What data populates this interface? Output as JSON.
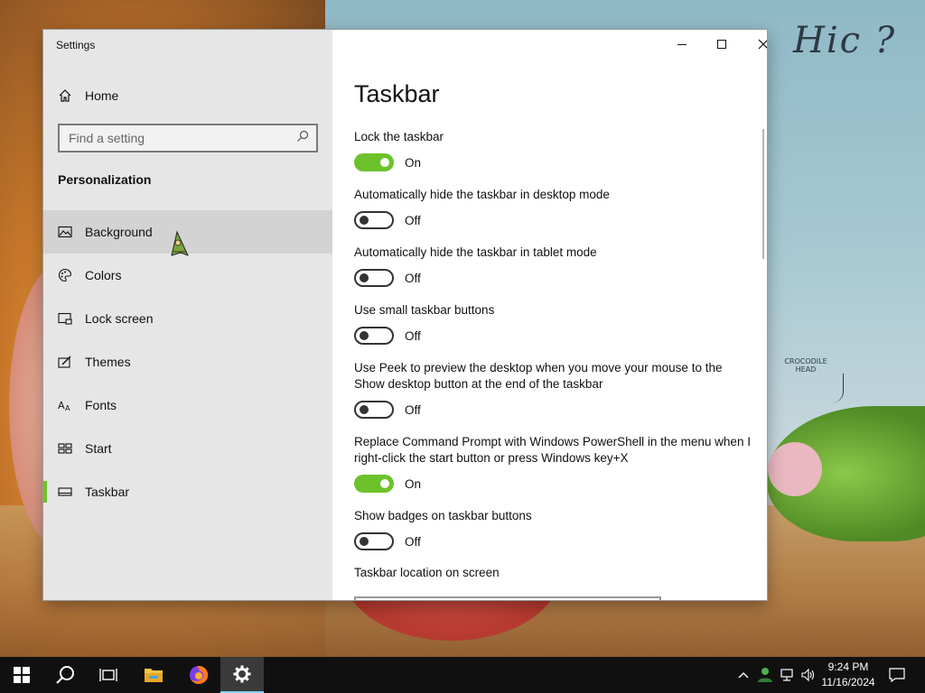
{
  "window": {
    "title": "Settings"
  },
  "sidebar": {
    "home_label": "Home",
    "search_placeholder": "Find a setting",
    "section_title": "Personalization",
    "items": [
      {
        "label": "Background",
        "icon": "image-icon"
      },
      {
        "label": "Colors",
        "icon": "palette-icon"
      },
      {
        "label": "Lock screen",
        "icon": "lock-screen-icon"
      },
      {
        "label": "Themes",
        "icon": "themes-icon"
      },
      {
        "label": "Fonts",
        "icon": "fonts-icon"
      },
      {
        "label": "Start",
        "icon": "start-icon"
      },
      {
        "label": "Taskbar",
        "icon": "taskbar-icon"
      }
    ],
    "selected": "Taskbar",
    "hovered": "Background"
  },
  "main": {
    "title": "Taskbar",
    "settings": [
      {
        "label": "Lock the taskbar",
        "state": "On"
      },
      {
        "label": "Automatically hide the taskbar in desktop mode",
        "state": "Off"
      },
      {
        "label": "Automatically hide the taskbar in tablet mode",
        "state": "Off"
      },
      {
        "label": "Use small taskbar buttons",
        "state": "Off"
      },
      {
        "label": "Use Peek to preview the desktop when you move your mouse to the Show desktop button at the end of the taskbar",
        "state": "Off"
      },
      {
        "label": "Replace Command Prompt with Windows PowerShell in the menu when I right-click the start button or press Windows key+X",
        "state": "On"
      },
      {
        "label": "Show badges on taskbar buttons",
        "state": "Off"
      }
    ],
    "location_label": "Taskbar location on screen"
  },
  "wallpaper": {
    "hic_text": "Hic ?",
    "croc_note": "CROCODILE HEAD"
  },
  "taskbar": {
    "buttons": [
      "windows-start-icon",
      "search-icon",
      "task-view-icon",
      "file-explorer-icon",
      "firefox-icon",
      "settings-gear-icon"
    ],
    "active": "settings-gear-icon",
    "time": "9:24 PM",
    "date": "11/16/2024"
  },
  "colors": {
    "accent": "#6dc22b",
    "taskbar": "#101010",
    "sidebar_bg": "#e6e6e6"
  }
}
